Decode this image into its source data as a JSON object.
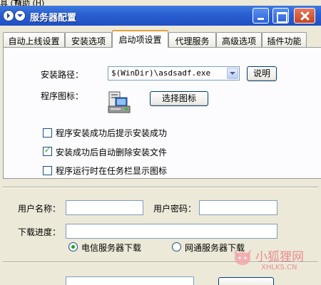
{
  "menubar": {
    "item1": "具 (T)",
    "item2": "帮助 (H)"
  },
  "window": {
    "title": "服务器配置"
  },
  "tabs": [
    {
      "label": "自动上线设置"
    },
    {
      "label": "安装选项"
    },
    {
      "label": "启动项设置",
      "active": true
    },
    {
      "label": "代理服务"
    },
    {
      "label": "高级选项"
    },
    {
      "label": "插件功能"
    }
  ],
  "install": {
    "path_label": "安装路径：",
    "path_value": "$(WinDir)\\asdsadf.exe",
    "explain_button": "说明",
    "icon_label": "程序图标：",
    "choose_icon_button": "选择图标"
  },
  "options": [
    {
      "label": "程序安装成功后提示安装成功",
      "checked": false
    },
    {
      "label": "安装成功后自动删除安装文件",
      "checked": true
    },
    {
      "label": "程序运行时在任务栏显示图标",
      "checked": false
    }
  ],
  "download": {
    "username_label": "用户名称：",
    "password_label": "用户密码：",
    "progress_label": "下载进度：",
    "radio_telecom": "电信服务器下载",
    "radio_netcom": "网通服务器下载",
    "selected": "telecom"
  },
  "watermark": {
    "text": "小狐狸网",
    "url": "XHLKS.CN"
  },
  "colors": {
    "titlebar": "#2a5fd0",
    "active_tab_accent": "#f0a038",
    "check": "#21a121"
  }
}
